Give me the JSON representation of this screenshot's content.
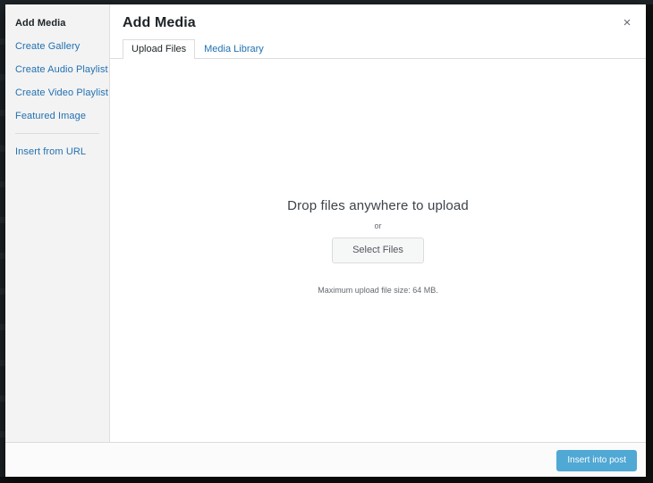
{
  "window": {
    "modal_title": "Add Media",
    "close_icon": "close-icon",
    "close_label": "×"
  },
  "sidebar": {
    "items": [
      {
        "label": "Add Media",
        "state": "active"
      },
      {
        "label": "Create Gallery",
        "state": "link"
      },
      {
        "label": "Create Audio Playlist",
        "state": "link"
      },
      {
        "label": "Create Video Playlist",
        "state": "link"
      },
      {
        "label": "Featured Image",
        "state": "link"
      }
    ],
    "secondary_items": [
      {
        "label": "Insert from URL",
        "state": "link"
      }
    ]
  },
  "tabs": [
    {
      "label": "Upload Files",
      "state": "active"
    },
    {
      "label": "Media Library",
      "state": "link"
    }
  ],
  "uploader": {
    "drop_instructions": "Drop files anywhere to upload",
    "or_label": "or",
    "select_files_label": "Select Files",
    "max_upload_size": "Maximum upload file size: 64 MB."
  },
  "toolbar": {
    "insert_label": "Insert into post"
  },
  "colors": {
    "accent_blue": "#2b96cc",
    "link_blue": "#2271b1",
    "sidebar_bg": "#f3f3f3",
    "admin_dark": "#1d2327",
    "text_dark": "#1d2327",
    "text_muted": "#646970"
  }
}
